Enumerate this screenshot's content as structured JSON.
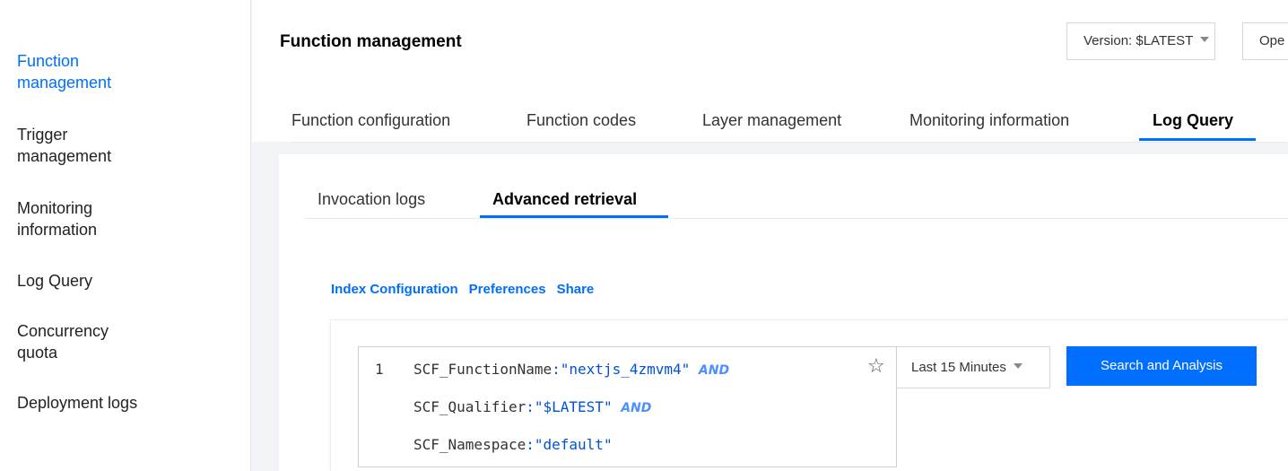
{
  "sidebar": {
    "items": [
      {
        "label_line1": "Function",
        "label_line2": "management",
        "active": true
      },
      {
        "label_line1": "Trigger",
        "label_line2": "management",
        "active": false
      },
      {
        "label_line1": "Monitoring",
        "label_line2": "information",
        "active": false
      },
      {
        "label_line1": "Log Query",
        "label_line2": "",
        "active": false
      },
      {
        "label_line1": "Concurrency",
        "label_line2": "quota",
        "active": false
      },
      {
        "label_line1": "Deployment logs",
        "label_line2": "",
        "active": false
      }
    ]
  },
  "header": {
    "title": "Function management",
    "version_select": "Version: $LATEST",
    "ops_button": "Ope"
  },
  "top_tabs": [
    {
      "label": "Function configuration",
      "active": false
    },
    {
      "label": "Function codes",
      "active": false
    },
    {
      "label": "Layer management",
      "active": false
    },
    {
      "label": "Monitoring information",
      "active": false
    },
    {
      "label": "Log Query",
      "active": true
    }
  ],
  "sub_tabs": [
    {
      "label": "Invocation logs",
      "active": false
    },
    {
      "label": "Advanced retrieval",
      "active": true
    }
  ],
  "links": {
    "index_configuration": "Index Configuration",
    "preferences": "Preferences",
    "share": "Share"
  },
  "query": {
    "line_number": "1",
    "lines": [
      {
        "field": "SCF_FunctionName",
        "sep": ":",
        "value": "\"nextjs_4zmvm4\"",
        "op": "AND"
      },
      {
        "field": "SCF_Qualifier",
        "sep": ":",
        "value": "\"$LATEST\"",
        "op": "AND"
      },
      {
        "field": "SCF_Namespace",
        "sep": ":",
        "value": "\"default\"",
        "op": ""
      }
    ],
    "favorite_icon": "star-icon",
    "time_range": "Last 15 Minutes",
    "search_button": "Search and Analysis"
  },
  "colors": {
    "accent": "#006eff",
    "string_value": "#0052d9",
    "operator": "#4a90ff"
  }
}
